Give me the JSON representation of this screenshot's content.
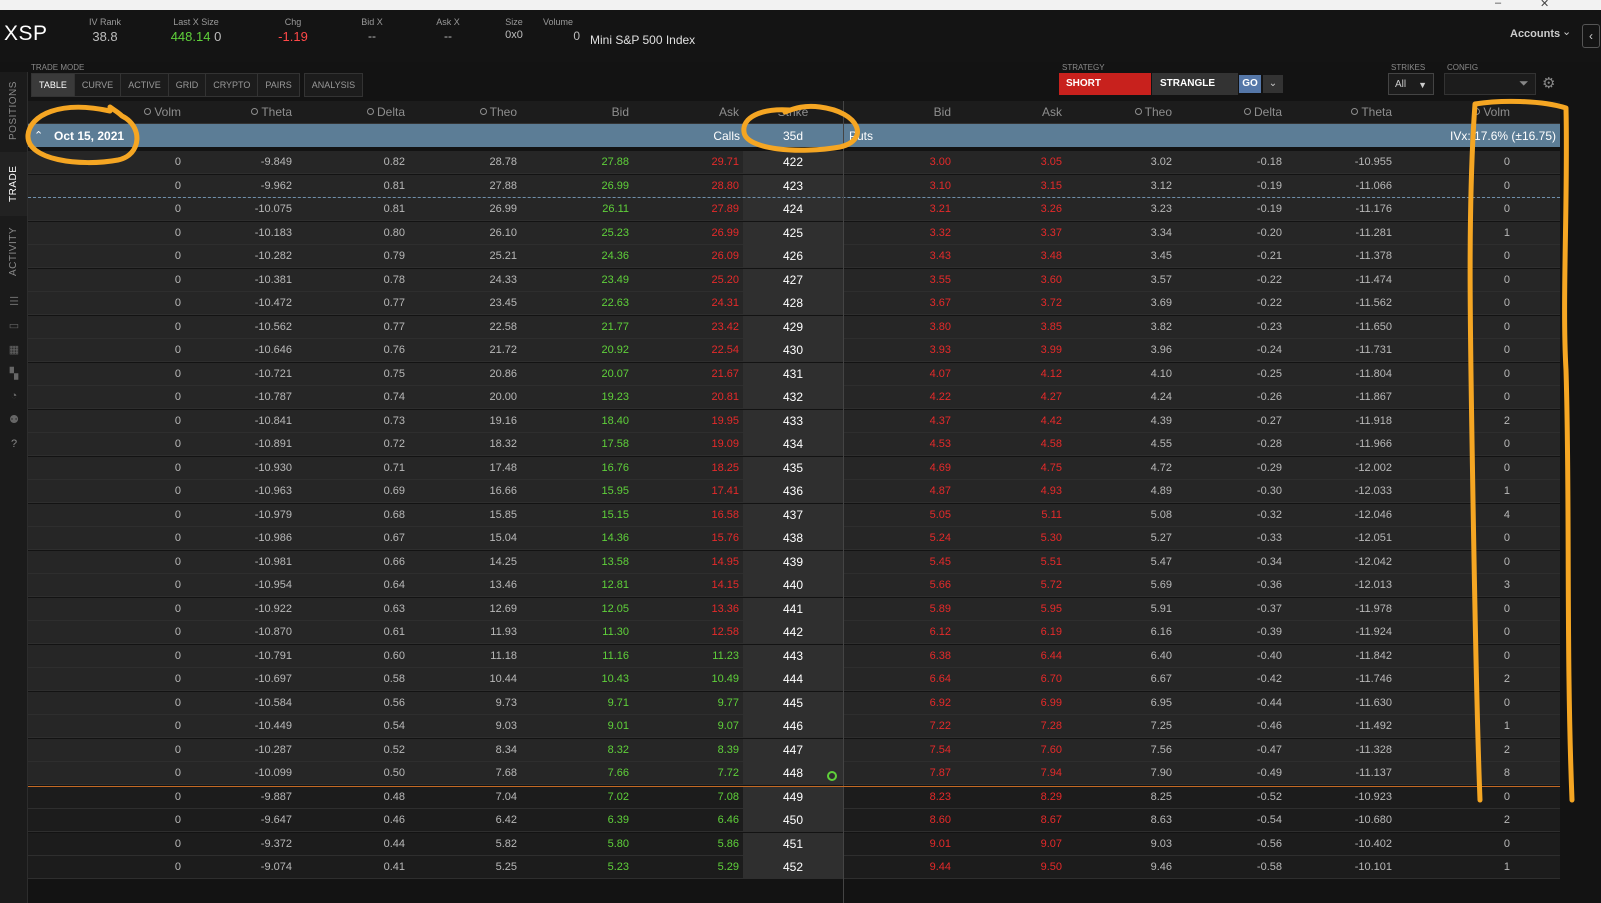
{
  "window": {
    "controls": [
      "–",
      "✕"
    ]
  },
  "header": {
    "symbol": "XSP",
    "fields": [
      {
        "label": "IV Rank",
        "value": "38.8",
        "color": "normal"
      },
      {
        "label": "Last X Size",
        "value": "448.14",
        "extra": "0",
        "color": "green"
      },
      {
        "label": "Chg",
        "value": "-1.19",
        "color": "red"
      },
      {
        "label": "Bid X",
        "value": "--",
        "color": "normal"
      },
      {
        "label": "Ask X",
        "value": "--",
        "color": "normal"
      },
      {
        "label": "Size",
        "value": "0x0",
        "color": "normal"
      },
      {
        "label": "Volume",
        "value": "0",
        "color": "normal"
      }
    ],
    "index_name": "Mini S&P 500 Index",
    "accounts_label": "Accounts"
  },
  "sidebar": {
    "tabs": [
      {
        "label": "POSITIONS",
        "active": false
      },
      {
        "label": "TRADE",
        "active": true
      },
      {
        "label": "ACTIVITY",
        "active": false
      }
    ],
    "icons": [
      "list-icon",
      "briefcase-icon",
      "calendar-icon",
      "grid-icon",
      "clock-icon",
      "people-icon",
      "help-icon"
    ]
  },
  "trade_mode": {
    "label": "TRADE MODE",
    "tabs": [
      "TABLE",
      "CURVE",
      "ACTIVE",
      "GRID",
      "CRYPTO",
      "PAIRS"
    ],
    "active": "TABLE",
    "analysis_label": "ANALYSIS"
  },
  "strategy": {
    "label": "STRATEGY",
    "side": "SHORT",
    "type": "STRANGLE",
    "go_label": "GO"
  },
  "strikes": {
    "label": "STRIKES",
    "value": "All"
  },
  "config": {
    "label": "CONFIG"
  },
  "columns": {
    "calls": [
      "Volm",
      "Theta",
      "Delta",
      "Theo",
      "Bid",
      "Ask"
    ],
    "strike": "Strike",
    "puts": [
      "Bid",
      "Ask",
      "Theo",
      "Delta",
      "Theta",
      "Volm"
    ]
  },
  "expiration": {
    "date": "Oct 15, 2021",
    "calls_label": "Calls",
    "days": "35d",
    "puts_label": "Puts",
    "ivx": "IVx: 17.6% (±16.75)"
  },
  "rows": [
    {
      "strike": "422",
      "call": {
        "volm": "0",
        "theta": "-9.849",
        "delta": "0.82",
        "theo": "28.78",
        "bid": "27.88",
        "ask": "29.71"
      },
      "put": {
        "bid": "3.00",
        "ask": "3.05",
        "theo": "3.02",
        "delta": "-0.18",
        "theta": "-10.955",
        "volm": "0"
      }
    },
    {
      "strike": "423",
      "call": {
        "volm": "0",
        "theta": "-9.962",
        "delta": "0.81",
        "theo": "27.88",
        "bid": "26.99",
        "ask": "28.80"
      },
      "put": {
        "bid": "3.10",
        "ask": "3.15",
        "theo": "3.12",
        "delta": "-0.19",
        "theta": "-11.066",
        "volm": "0"
      }
    },
    {
      "strike": "424",
      "call": {
        "volm": "0",
        "theta": "-10.075",
        "delta": "0.81",
        "theo": "26.99",
        "bid": "26.11",
        "ask": "27.89"
      },
      "put": {
        "bid": "3.21",
        "ask": "3.26",
        "theo": "3.23",
        "delta": "-0.19",
        "theta": "-11.176",
        "volm": "0"
      }
    },
    {
      "strike": "425",
      "call": {
        "volm": "0",
        "theta": "-10.183",
        "delta": "0.80",
        "theo": "26.10",
        "bid": "25.23",
        "ask": "26.99"
      },
      "put": {
        "bid": "3.32",
        "ask": "3.37",
        "theo": "3.34",
        "delta": "-0.20",
        "theta": "-11.281",
        "volm": "1"
      }
    },
    {
      "strike": "426",
      "call": {
        "volm": "0",
        "theta": "-10.282",
        "delta": "0.79",
        "theo": "25.21",
        "bid": "24.36",
        "ask": "26.09"
      },
      "put": {
        "bid": "3.43",
        "ask": "3.48",
        "theo": "3.45",
        "delta": "-0.21",
        "theta": "-11.378",
        "volm": "0"
      }
    },
    {
      "strike": "427",
      "call": {
        "volm": "0",
        "theta": "-10.381",
        "delta": "0.78",
        "theo": "24.33",
        "bid": "23.49",
        "ask": "25.20"
      },
      "put": {
        "bid": "3.55",
        "ask": "3.60",
        "theo": "3.57",
        "delta": "-0.22",
        "theta": "-11.474",
        "volm": "0"
      }
    },
    {
      "strike": "428",
      "call": {
        "volm": "0",
        "theta": "-10.472",
        "delta": "0.77",
        "theo": "23.45",
        "bid": "22.63",
        "ask": "24.31"
      },
      "put": {
        "bid": "3.67",
        "ask": "3.72",
        "theo": "3.69",
        "delta": "-0.22",
        "theta": "-11.562",
        "volm": "0"
      }
    },
    {
      "strike": "429",
      "call": {
        "volm": "0",
        "theta": "-10.562",
        "delta": "0.77",
        "theo": "22.58",
        "bid": "21.77",
        "ask": "23.42"
      },
      "put": {
        "bid": "3.80",
        "ask": "3.85",
        "theo": "3.82",
        "delta": "-0.23",
        "theta": "-11.650",
        "volm": "0"
      }
    },
    {
      "strike": "430",
      "call": {
        "volm": "0",
        "theta": "-10.646",
        "delta": "0.76",
        "theo": "21.72",
        "bid": "20.92",
        "ask": "22.54"
      },
      "put": {
        "bid": "3.93",
        "ask": "3.99",
        "theo": "3.96",
        "delta": "-0.24",
        "theta": "-11.731",
        "volm": "0"
      }
    },
    {
      "strike": "431",
      "call": {
        "volm": "0",
        "theta": "-10.721",
        "delta": "0.75",
        "theo": "20.86",
        "bid": "20.07",
        "ask": "21.67"
      },
      "put": {
        "bid": "4.07",
        "ask": "4.12",
        "theo": "4.10",
        "delta": "-0.25",
        "theta": "-11.804",
        "volm": "0"
      }
    },
    {
      "strike": "432",
      "call": {
        "volm": "0",
        "theta": "-10.787",
        "delta": "0.74",
        "theo": "20.00",
        "bid": "19.23",
        "ask": "20.81"
      },
      "put": {
        "bid": "4.22",
        "ask": "4.27",
        "theo": "4.24",
        "delta": "-0.26",
        "theta": "-11.867",
        "volm": "0"
      }
    },
    {
      "strike": "433",
      "call": {
        "volm": "0",
        "theta": "-10.841",
        "delta": "0.73",
        "theo": "19.16",
        "bid": "18.40",
        "ask": "19.95"
      },
      "put": {
        "bid": "4.37",
        "ask": "4.42",
        "theo": "4.39",
        "delta": "-0.27",
        "theta": "-11.918",
        "volm": "2"
      }
    },
    {
      "strike": "434",
      "call": {
        "volm": "0",
        "theta": "-10.891",
        "delta": "0.72",
        "theo": "18.32",
        "bid": "17.58",
        "ask": "19.09"
      },
      "put": {
        "bid": "4.53",
        "ask": "4.58",
        "theo": "4.55",
        "delta": "-0.28",
        "theta": "-11.966",
        "volm": "0"
      }
    },
    {
      "strike": "435",
      "call": {
        "volm": "0",
        "theta": "-10.930",
        "delta": "0.71",
        "theo": "17.48",
        "bid": "16.76",
        "ask": "18.25"
      },
      "put": {
        "bid": "4.69",
        "ask": "4.75",
        "theo": "4.72",
        "delta": "-0.29",
        "theta": "-12.002",
        "volm": "0"
      }
    },
    {
      "strike": "436",
      "call": {
        "volm": "0",
        "theta": "-10.963",
        "delta": "0.69",
        "theo": "16.66",
        "bid": "15.95",
        "ask": "17.41"
      },
      "put": {
        "bid": "4.87",
        "ask": "4.93",
        "theo": "4.89",
        "delta": "-0.30",
        "theta": "-12.033",
        "volm": "1"
      }
    },
    {
      "strike": "437",
      "call": {
        "volm": "0",
        "theta": "-10.979",
        "delta": "0.68",
        "theo": "15.85",
        "bid": "15.15",
        "ask": "16.58"
      },
      "put": {
        "bid": "5.05",
        "ask": "5.11",
        "theo": "5.08",
        "delta": "-0.32",
        "theta": "-12.046",
        "volm": "4"
      }
    },
    {
      "strike": "438",
      "call": {
        "volm": "0",
        "theta": "-10.986",
        "delta": "0.67",
        "theo": "15.04",
        "bid": "14.36",
        "ask": "15.76"
      },
      "put": {
        "bid": "5.24",
        "ask": "5.30",
        "theo": "5.27",
        "delta": "-0.33",
        "theta": "-12.051",
        "volm": "0"
      }
    },
    {
      "strike": "439",
      "call": {
        "volm": "0",
        "theta": "-10.981",
        "delta": "0.66",
        "theo": "14.25",
        "bid": "13.58",
        "ask": "14.95"
      },
      "put": {
        "bid": "5.45",
        "ask": "5.51",
        "theo": "5.47",
        "delta": "-0.34",
        "theta": "-12.042",
        "volm": "0"
      }
    },
    {
      "strike": "440",
      "call": {
        "volm": "0",
        "theta": "-10.954",
        "delta": "0.64",
        "theo": "13.46",
        "bid": "12.81",
        "ask": "14.15"
      },
      "put": {
        "bid": "5.66",
        "ask": "5.72",
        "theo": "5.69",
        "delta": "-0.36",
        "theta": "-12.013",
        "volm": "3"
      }
    },
    {
      "strike": "441",
      "call": {
        "volm": "0",
        "theta": "-10.922",
        "delta": "0.63",
        "theo": "12.69",
        "bid": "12.05",
        "ask": "13.36"
      },
      "put": {
        "bid": "5.89",
        "ask": "5.95",
        "theo": "5.91",
        "delta": "-0.37",
        "theta": "-11.978",
        "volm": "0"
      }
    },
    {
      "strike": "442",
      "call": {
        "volm": "0",
        "theta": "-10.870",
        "delta": "0.61",
        "theo": "11.93",
        "bid": "11.30",
        "ask": "12.58"
      },
      "put": {
        "bid": "6.12",
        "ask": "6.19",
        "theo": "6.16",
        "delta": "-0.39",
        "theta": "-11.924",
        "volm": "0"
      }
    },
    {
      "strike": "443",
      "call": {
        "volm": "0",
        "theta": "-10.791",
        "delta": "0.60",
        "theo": "11.18",
        "bid": "11.16",
        "ask": "11.23"
      },
      "put": {
        "bid": "6.38",
        "ask": "6.44",
        "theo": "6.40",
        "delta": "-0.40",
        "theta": "-11.842",
        "volm": "0"
      }
    },
    {
      "strike": "444",
      "call": {
        "volm": "0",
        "theta": "-10.697",
        "delta": "0.58",
        "theo": "10.44",
        "bid": "10.43",
        "ask": "10.49"
      },
      "put": {
        "bid": "6.64",
        "ask": "6.70",
        "theo": "6.67",
        "delta": "-0.42",
        "theta": "-11.746",
        "volm": "2"
      }
    },
    {
      "strike": "445",
      "call": {
        "volm": "0",
        "theta": "-10.584",
        "delta": "0.56",
        "theo": "9.73",
        "bid": "9.71",
        "ask": "9.77"
      },
      "put": {
        "bid": "6.92",
        "ask": "6.99",
        "theo": "6.95",
        "delta": "-0.44",
        "theta": "-11.630",
        "volm": "0"
      }
    },
    {
      "strike": "446",
      "call": {
        "volm": "0",
        "theta": "-10.449",
        "delta": "0.54",
        "theo": "9.03",
        "bid": "9.01",
        "ask": "9.07"
      },
      "put": {
        "bid": "7.22",
        "ask": "7.28",
        "theo": "7.25",
        "delta": "-0.46",
        "theta": "-11.492",
        "volm": "1"
      }
    },
    {
      "strike": "447",
      "call": {
        "volm": "0",
        "theta": "-10.287",
        "delta": "0.52",
        "theo": "8.34",
        "bid": "8.32",
        "ask": "8.39"
      },
      "put": {
        "bid": "7.54",
        "ask": "7.60",
        "theo": "7.56",
        "delta": "-0.47",
        "theta": "-11.328",
        "volm": "2"
      }
    },
    {
      "strike": "448",
      "call": {
        "volm": "0",
        "theta": "-10.099",
        "delta": "0.50",
        "theo": "7.68",
        "bid": "7.66",
        "ask": "7.72"
      },
      "put": {
        "bid": "7.87",
        "ask": "7.94",
        "theo": "7.90",
        "delta": "-0.49",
        "theta": "-11.137",
        "volm": "8"
      }
    },
    {
      "strike": "449",
      "call": {
        "volm": "0",
        "theta": "-9.887",
        "delta": "0.48",
        "theo": "7.04",
        "bid": "7.02",
        "ask": "7.08"
      },
      "put": {
        "bid": "8.23",
        "ask": "8.29",
        "theo": "8.25",
        "delta": "-0.52",
        "theta": "-10.923",
        "volm": "0"
      }
    },
    {
      "strike": "450",
      "call": {
        "volm": "0",
        "theta": "-9.647",
        "delta": "0.46",
        "theo": "6.42",
        "bid": "6.39",
        "ask": "6.46"
      },
      "put": {
        "bid": "8.60",
        "ask": "8.67",
        "theo": "8.63",
        "delta": "-0.54",
        "theta": "-10.680",
        "volm": "2"
      }
    },
    {
      "strike": "451",
      "call": {
        "volm": "0",
        "theta": "-9.372",
        "delta": "0.44",
        "theo": "5.82",
        "bid": "5.80",
        "ask": "5.86"
      },
      "put": {
        "bid": "9.01",
        "ask": "9.07",
        "theo": "9.03",
        "delta": "-0.56",
        "theta": "-10.402",
        "volm": "0"
      }
    },
    {
      "strike": "452",
      "call": {
        "volm": "0",
        "theta": "-9.074",
        "delta": "0.41",
        "theo": "5.25",
        "bid": "5.23",
        "ask": "5.29"
      },
      "put": {
        "bid": "9.44",
        "ask": "9.50",
        "theo": "9.46",
        "delta": "-0.58",
        "theta": "-10.101",
        "volm": "1"
      }
    }
  ],
  "colors": {
    "call_bid": "#5fd03a",
    "call_ask_itm": "#e52a2a",
    "call_ask_otm": "#5fd03a",
    "put_bid": "#e52a2a",
    "put_ask": "#e52a2a",
    "annotation": "#f5a623",
    "expiration_bar": "#5c7d96",
    "short_button": "#c8211d",
    "go_button": "#5577a8"
  }
}
